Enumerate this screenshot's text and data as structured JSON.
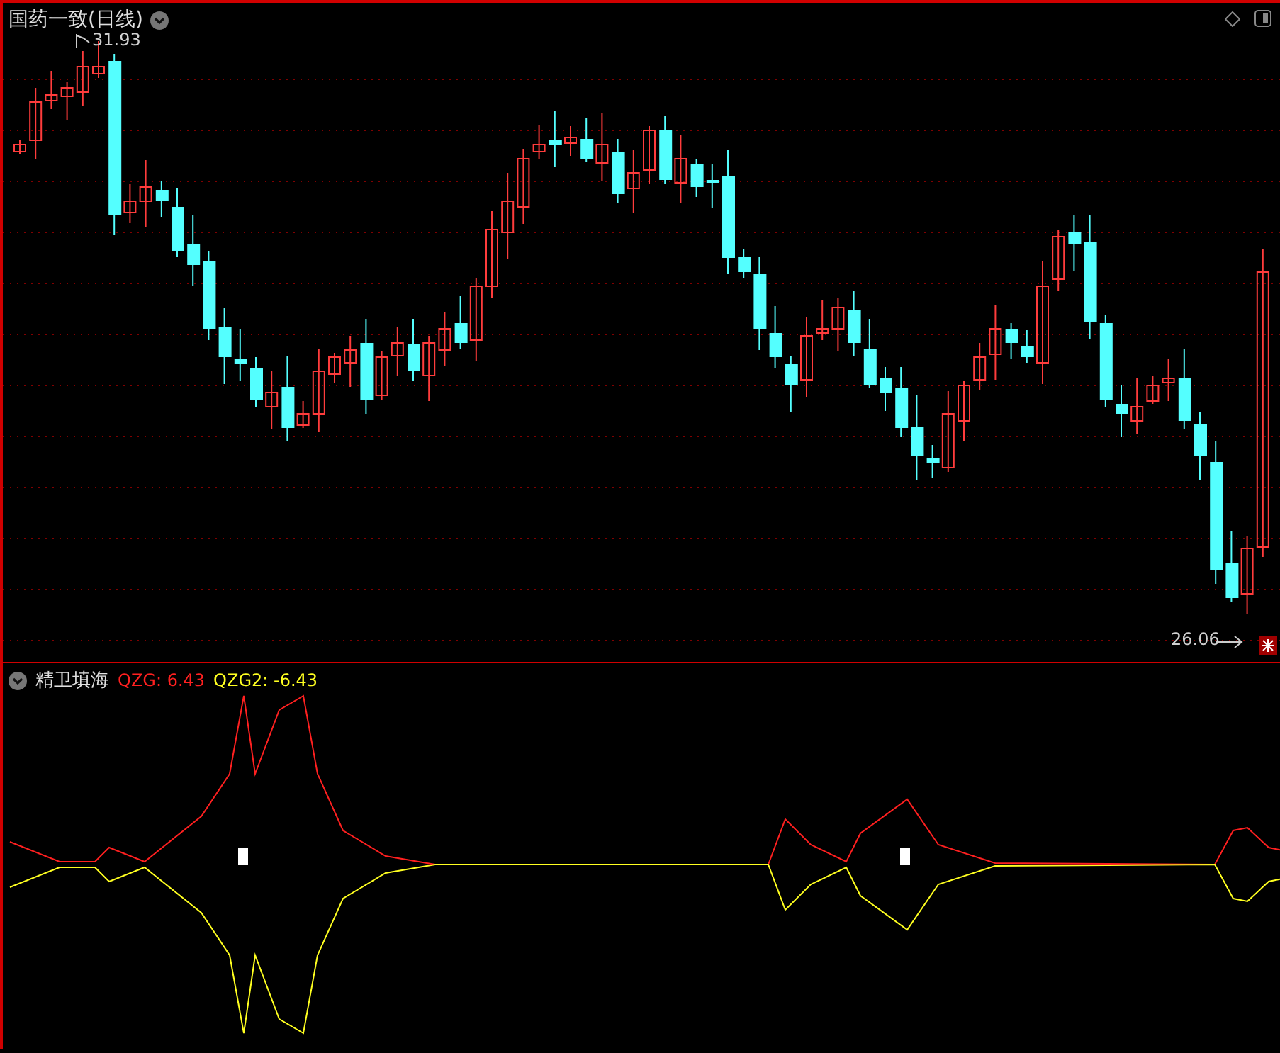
{
  "main_chart": {
    "title": "国药一致(日线)",
    "high_label": "31.93",
    "low_label": "26.06"
  },
  "indicator": {
    "name": "精卫填海",
    "readings": [
      {
        "text": "QZG: 6.43",
        "color": "#ff2020"
      },
      {
        "text": "QZG2: -6.43",
        "color": "#ffff20"
      }
    ]
  }
}
